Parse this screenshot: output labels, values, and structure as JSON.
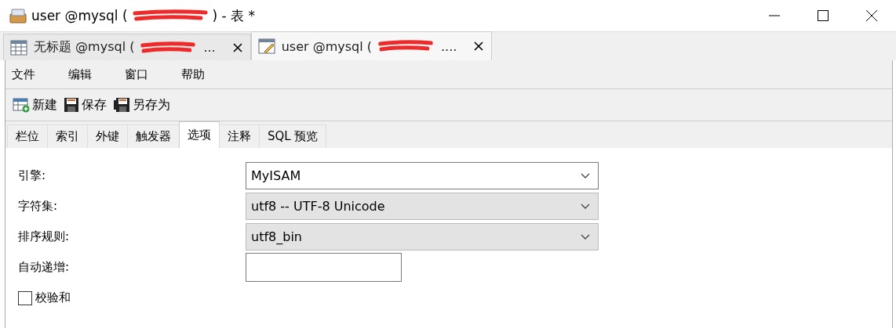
{
  "window": {
    "title": "user @mysql (",
    "title_redacted": true,
    "title_end": ") - 表 *"
  },
  "doc_tabs": [
    {
      "label": "无标题 @mysql (",
      "redacted": true,
      "label_end": "...",
      "kind": "query",
      "selected": false
    },
    {
      "label": "user @mysql (",
      "redacted": true,
      "label_end": "....",
      "kind": "table",
      "selected": true
    }
  ],
  "menu": [
    "文件",
    "编辑",
    "窗口",
    "帮助"
  ],
  "toolbar": [
    {
      "label": "新建",
      "kind": "new"
    },
    {
      "label": "保存",
      "kind": "save"
    },
    {
      "label": "另存为",
      "kind": "saveas"
    }
  ],
  "tabs": [
    {
      "label": "栏位",
      "selected": false
    },
    {
      "label": "索引",
      "selected": false
    },
    {
      "label": "外键",
      "selected": false
    },
    {
      "label": "触发器",
      "selected": false
    },
    {
      "label": "选项",
      "selected": true
    },
    {
      "label": "注释",
      "selected": false
    },
    {
      "label": "SQL 预览",
      "selected": false
    }
  ],
  "options": [
    {
      "label": "引擎:",
      "kind": "select",
      "value": "MyISAM",
      "disabled": false
    },
    {
      "label": "字符集:",
      "kind": "select",
      "value": "utf8 -- UTF-8 Unicode",
      "disabled": true
    },
    {
      "label": "排序规则:",
      "kind": "select",
      "value": "utf8_bin",
      "disabled": true
    },
    {
      "label": "自动递增:",
      "kind": "input"
    },
    {
      "label": "校验和",
      "kind": "checkbox",
      "checked": false
    }
  ]
}
